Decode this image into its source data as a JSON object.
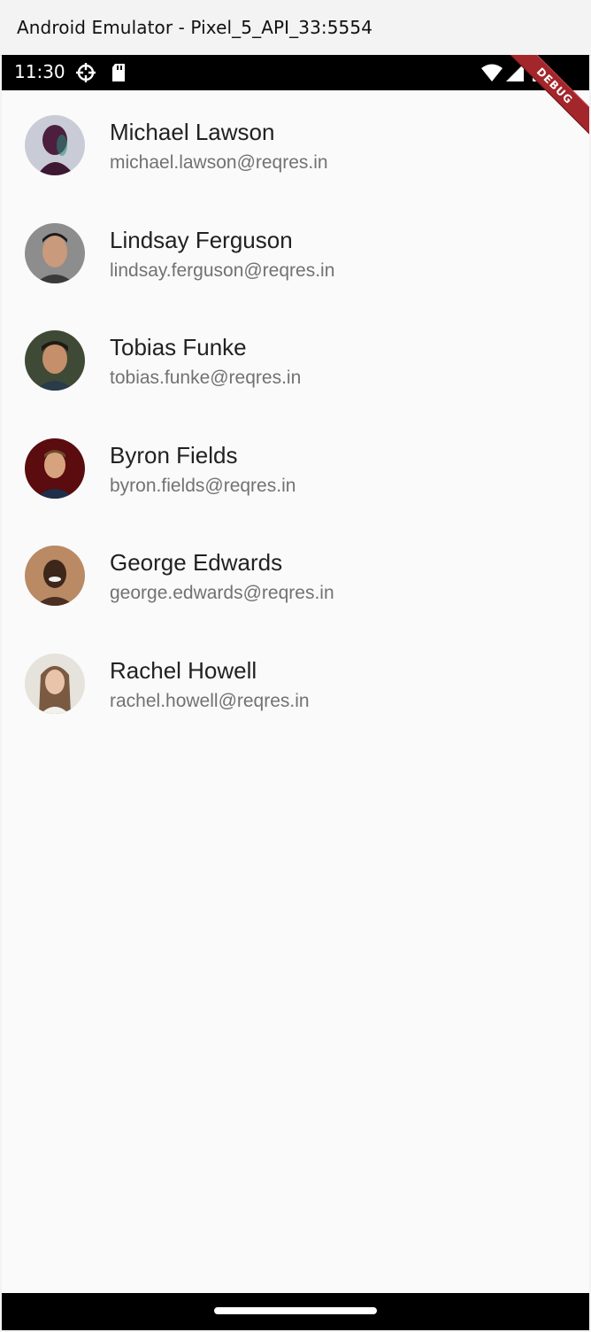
{
  "window": {
    "title": "Android Emulator - Pixel_5_API_33:5554"
  },
  "status_bar": {
    "time": "11:30",
    "icons": [
      "settings-icon",
      "sd-card-icon",
      "wifi-icon",
      "signal-icon",
      "battery-icon"
    ]
  },
  "debug_banner": {
    "label": "DEBUG",
    "color": "#a3262b"
  },
  "users": [
    {
      "name": "Michael Lawson",
      "email": "michael.lawson@reqres.in",
      "avatar": "avatar-purple"
    },
    {
      "name": "Lindsay Ferguson",
      "email": "lindsay.ferguson@reqres.in",
      "avatar": "avatar-grey"
    },
    {
      "name": "Tobias Funke",
      "email": "tobias.funke@reqres.in",
      "avatar": "avatar-green"
    },
    {
      "name": "Byron Fields",
      "email": "byron.fields@reqres.in",
      "avatar": "avatar-red"
    },
    {
      "name": "George Edwards",
      "email": "george.edwards@reqres.in",
      "avatar": "avatar-brown"
    },
    {
      "name": "Rachel Howell",
      "email": "rachel.howell@reqres.in",
      "avatar": "avatar-light"
    }
  ],
  "colors": {
    "primary_text": "#212121",
    "secondary_text": "#727272",
    "background": "#fafafa"
  }
}
